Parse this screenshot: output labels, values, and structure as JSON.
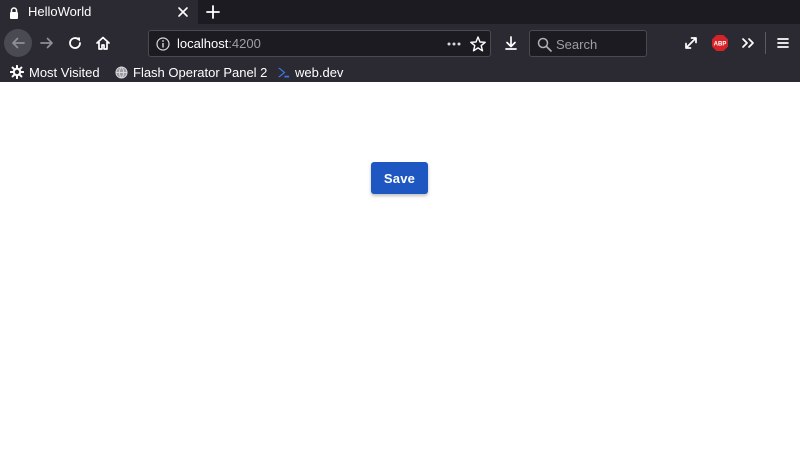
{
  "tab": {
    "title": "HelloWorld"
  },
  "urlbar": {
    "host": "localhost",
    "port": ":4200"
  },
  "search": {
    "placeholder": "Search"
  },
  "bookmarks": [
    {
      "label": "Most Visited"
    },
    {
      "label": "Flash Operator Panel 2"
    },
    {
      "label": "web.dev"
    }
  ],
  "extensions": {
    "abp_label": "ABP"
  },
  "page": {
    "save_label": "Save"
  },
  "colors": {
    "chrome_bg": "#2b2a33",
    "tabstrip_bg": "#1c1b22",
    "save_button_bg": "#1e57c1",
    "abp_red": "#d6232a"
  },
  "icons": {
    "tab": [
      "lock-icon",
      "close-icon",
      "plus-icon"
    ],
    "nav": [
      "back-arrow-icon",
      "forward-arrow-icon",
      "reload-icon",
      "home-icon",
      "info-icon",
      "more-dots-icon",
      "star-icon",
      "download-icon",
      "search-icon",
      "fullscreen-icon",
      "abp-icon",
      "overflow-chevron-icon",
      "hamburger-menu-icon"
    ],
    "bookmarks": [
      "gear-icon",
      "globe-icon",
      "web-dev-icon"
    ]
  }
}
